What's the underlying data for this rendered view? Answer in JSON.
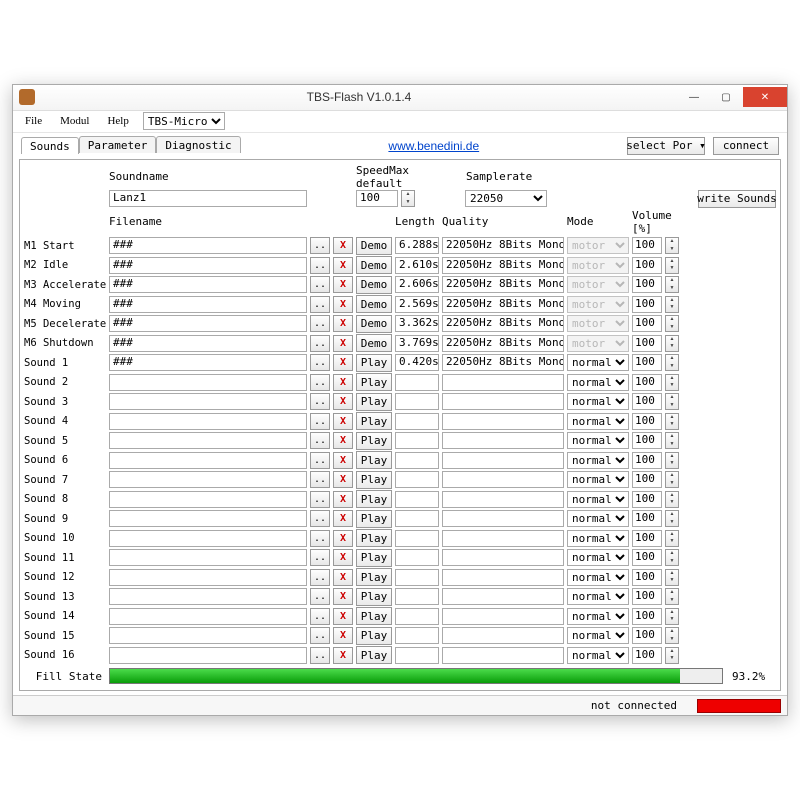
{
  "window": {
    "title": "TBS-Flash V1.0.1.4"
  },
  "titlebuttons": {
    "min": "—",
    "max": "▢",
    "close": "✕"
  },
  "menu": {
    "file": "File",
    "modul": "Modul",
    "help": "Help",
    "device": "TBS-Micro"
  },
  "top": {
    "link": "www.benedini.de",
    "port_label": "select Por",
    "connect": "connect"
  },
  "tabs": {
    "sounds": "Sounds",
    "parameter": "Parameter",
    "diagnostic": "Diagnostic"
  },
  "headers": {
    "soundname": "Soundname",
    "filename": "Filename",
    "speedmax": "SpeedMax default",
    "samplerate": "Samplerate",
    "length": "Length",
    "quality": "Quality",
    "mode": "Mode",
    "volume": "Volume [%]",
    "write": "write Sounds"
  },
  "soundname_value": "Lanz1",
  "speedmax_value": "100",
  "samplerate_value": "22050",
  "browse_label": "..",
  "delete_label": "X",
  "demo_label": "Demo",
  "play_label": "Play",
  "mode_motor": "motor",
  "mode_normal": "normal",
  "rows": [
    {
      "name": "M1 Start",
      "file": "###",
      "btn": "Demo",
      "len": "6.288s",
      "qual": "22050Hz 8Bits Mono",
      "mode": "motor",
      "dim": true,
      "vol": "100"
    },
    {
      "name": "M2 Idle",
      "file": "###",
      "btn": "Demo",
      "len": "2.610s",
      "qual": "22050Hz 8Bits Mono",
      "mode": "motor",
      "dim": true,
      "vol": "100"
    },
    {
      "name": "M3 Accelerate",
      "file": "###",
      "btn": "Demo",
      "len": "2.606s",
      "qual": "22050Hz 8Bits Mono",
      "mode": "motor",
      "dim": true,
      "vol": "100"
    },
    {
      "name": "M4 Moving",
      "file": "###",
      "btn": "Demo",
      "len": "2.569s",
      "qual": "22050Hz 8Bits Mono",
      "mode": "motor",
      "dim": true,
      "vol": "100"
    },
    {
      "name": "M5 Decelerate",
      "file": "###",
      "btn": "Demo",
      "len": "3.362s",
      "qual": "22050Hz 8Bits Mono",
      "mode": "motor",
      "dim": true,
      "vol": "100"
    },
    {
      "name": "M6 Shutdown",
      "file": "###",
      "btn": "Demo",
      "len": "3.769s",
      "qual": "22050Hz 8Bits Mono",
      "mode": "motor",
      "dim": true,
      "vol": "100"
    },
    {
      "name": "Sound 1",
      "file": "###",
      "btn": "Play",
      "len": "0.420s",
      "qual": "22050Hz 8Bits Mono",
      "mode": "normal",
      "dim": false,
      "vol": "100"
    },
    {
      "name": "Sound 2",
      "file": "",
      "btn": "Play",
      "len": "",
      "qual": "",
      "mode": "normal",
      "dim": false,
      "vol": "100"
    },
    {
      "name": "Sound 3",
      "file": "",
      "btn": "Play",
      "len": "",
      "qual": "",
      "mode": "normal",
      "dim": false,
      "vol": "100"
    },
    {
      "name": "Sound 4",
      "file": "",
      "btn": "Play",
      "len": "",
      "qual": "",
      "mode": "normal",
      "dim": false,
      "vol": "100"
    },
    {
      "name": "Sound 5",
      "file": "",
      "btn": "Play",
      "len": "",
      "qual": "",
      "mode": "normal",
      "dim": false,
      "vol": "100"
    },
    {
      "name": "Sound 6",
      "file": "",
      "btn": "Play",
      "len": "",
      "qual": "",
      "mode": "normal",
      "dim": false,
      "vol": "100"
    },
    {
      "name": "Sound 7",
      "file": "",
      "btn": "Play",
      "len": "",
      "qual": "",
      "mode": "normal",
      "dim": false,
      "vol": "100"
    },
    {
      "name": "Sound 8",
      "file": "",
      "btn": "Play",
      "len": "",
      "qual": "",
      "mode": "normal",
      "dim": false,
      "vol": "100"
    },
    {
      "name": "Sound 9",
      "file": "",
      "btn": "Play",
      "len": "",
      "qual": "",
      "mode": "normal",
      "dim": false,
      "vol": "100"
    },
    {
      "name": "Sound 10",
      "file": "",
      "btn": "Play",
      "len": "",
      "qual": "",
      "mode": "normal",
      "dim": false,
      "vol": "100"
    },
    {
      "name": "Sound 11",
      "file": "",
      "btn": "Play",
      "len": "",
      "qual": "",
      "mode": "normal",
      "dim": false,
      "vol": "100"
    },
    {
      "name": "Sound 12",
      "file": "",
      "btn": "Play",
      "len": "",
      "qual": "",
      "mode": "normal",
      "dim": false,
      "vol": "100"
    },
    {
      "name": "Sound 13",
      "file": "",
      "btn": "Play",
      "len": "",
      "qual": "",
      "mode": "normal",
      "dim": false,
      "vol": "100"
    },
    {
      "name": "Sound 14",
      "file": "",
      "btn": "Play",
      "len": "",
      "qual": "",
      "mode": "normal",
      "dim": false,
      "vol": "100"
    },
    {
      "name": "Sound 15",
      "file": "",
      "btn": "Play",
      "len": "",
      "qual": "",
      "mode": "normal",
      "dim": false,
      "vol": "100"
    },
    {
      "name": "Sound 16",
      "file": "",
      "btn": "Play",
      "len": "",
      "qual": "",
      "mode": "normal",
      "dim": false,
      "vol": "100"
    }
  ],
  "fill": {
    "label": "Fill State",
    "pct_text": "93.2%",
    "pct": 93.2
  },
  "status": {
    "conn": "not connected"
  }
}
